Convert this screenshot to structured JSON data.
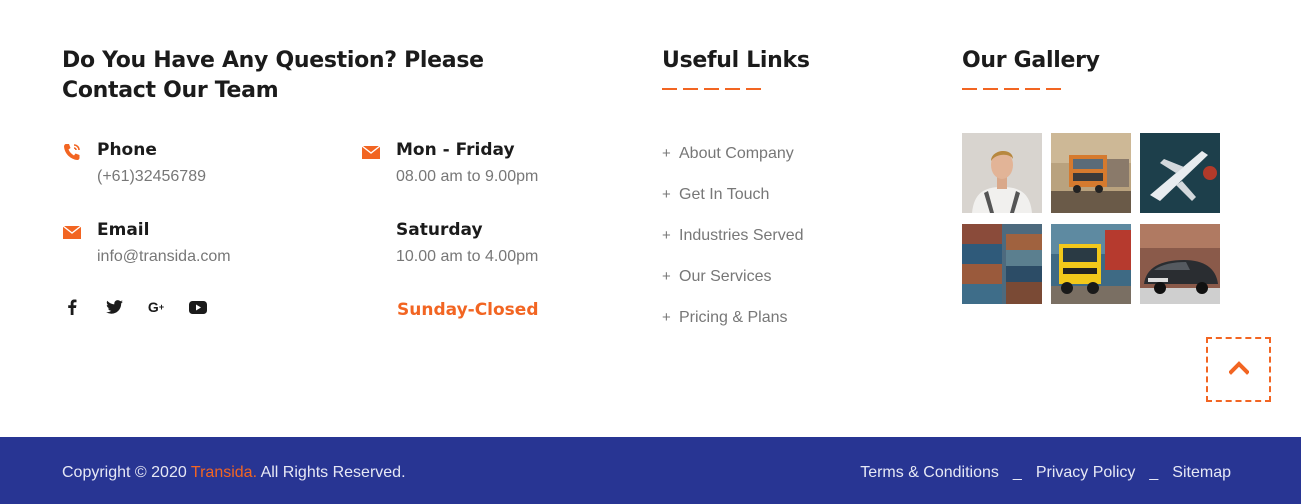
{
  "contact": {
    "title_line1": "Do You Have Any Question? Please",
    "title_line2": "Contact Our Team",
    "phone_label": "Phone",
    "phone_value": "(+61)32456789",
    "email_label": "Email",
    "email_value": "info@transida.com",
    "weekday_label": "Mon - Friday",
    "weekday_hours": "08.00 am to 9.00pm",
    "saturday_label": "Saturday",
    "saturday_hours": "10.00 am to 4.00pm",
    "sunday_text": "Sunday-Closed",
    "social": [
      {
        "icon": "facebook-icon",
        "glyph": "f"
      },
      {
        "icon": "twitter-icon",
        "glyph": "t"
      },
      {
        "icon": "google-plus-icon",
        "glyph": "G+"
      },
      {
        "icon": "youtube-icon",
        "glyph": "▶"
      }
    ]
  },
  "useful_links": {
    "title": "Useful Links",
    "plus": "+",
    "items": [
      "About Company",
      "Get In Touch",
      "Industries Served",
      "Our Services",
      "Pricing & Plans"
    ]
  },
  "gallery": {
    "title": "Our Gallery",
    "images": [
      "worker-photo",
      "truck-photo",
      "airplane-photo",
      "containers-photo",
      "yellow-truck-photo",
      "car-photo"
    ]
  },
  "footer": {
    "copyright_prefix": "Copyright © 2020 ",
    "brand": "Transida.",
    "copyright_suffix": " All Rights Reserved.",
    "links": [
      "Terms & Conditions",
      "Privacy Policy",
      "Sitemap"
    ],
    "separator": "_"
  },
  "colors": {
    "accent": "#f26522",
    "footer_bg": "#283593",
    "heading": "#1b1b1b",
    "muted_text": "#777777"
  }
}
